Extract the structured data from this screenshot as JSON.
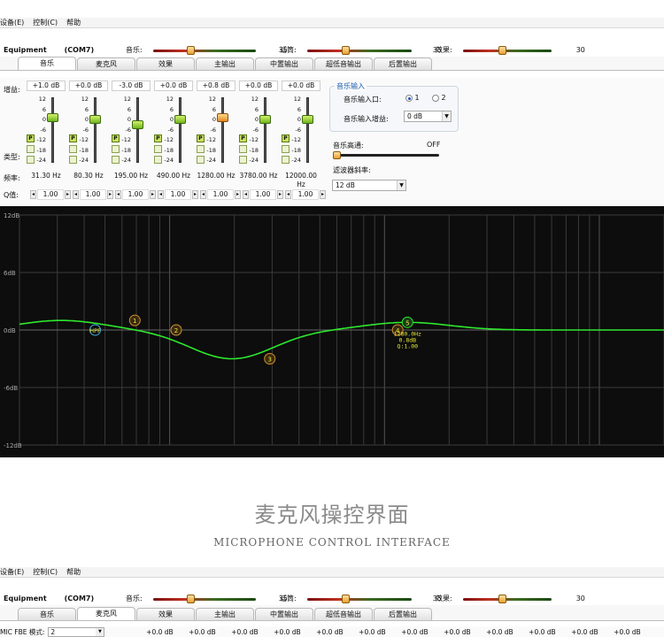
{
  "menu": [
    "设备(E)",
    "控制(C)",
    "帮助"
  ],
  "device": {
    "name": "Equipment",
    "port": "(COM7)"
  },
  "levels": [
    {
      "label": "音乐:",
      "value": "35",
      "position": 0.35
    },
    {
      "label": "话筒:",
      "value": "35",
      "position": 0.35
    },
    {
      "label": "效果:",
      "value": "30",
      "position": 0.3
    }
  ],
  "tabs": [
    "音乐",
    "麦克风",
    "效果",
    "主输出",
    "中置输出",
    "超低音输出",
    "后置输出"
  ],
  "active_tab_top": 0,
  "active_tab_bottom": 1,
  "eq": {
    "row_labels": {
      "gain": "增益:",
      "type": "类型:",
      "freq": "频率:",
      "q": "Q值:"
    },
    "scale": [
      "12",
      "6",
      "0",
      "-6",
      "-12",
      "-18",
      "-24"
    ],
    "type_badge": "P",
    "bands": [
      {
        "gain": "+1.0 dB",
        "freq": "31.30 Hz",
        "q": "1.00",
        "level": 1.0,
        "highlight": false
      },
      {
        "gain": "+0.0 dB",
        "freq": "80.30 Hz",
        "q": "1.00",
        "level": 0.0,
        "highlight": false
      },
      {
        "gain": "-3.0 dB",
        "freq": "195.00 Hz",
        "q": "1.00",
        "level": -3.0,
        "highlight": false
      },
      {
        "gain": "+0.0 dB",
        "freq": "490.00 Hz",
        "q": "1.00",
        "level": 0.0,
        "highlight": false
      },
      {
        "gain": "+0.8 dB",
        "freq": "1280.00 Hz",
        "q": "1.00",
        "level": 0.8,
        "highlight": true
      },
      {
        "gain": "+0.0 dB",
        "freq": "3780.00 Hz",
        "q": "1.00",
        "level": 0.0,
        "highlight": false
      },
      {
        "gain": "+0.0 dB",
        "freq": "12000.00 Hz",
        "q": "1.00",
        "level": 0.0,
        "highlight": false
      }
    ]
  },
  "music_input": {
    "title": "音乐输入",
    "port_label": "音乐输入口:",
    "options": [
      "1",
      "2"
    ],
    "selected": "1",
    "gain_label": "音乐输入增益:",
    "gain_value": "0 dB"
  },
  "highpass": {
    "label": "音乐高通:",
    "value": "OFF",
    "position": 0.0
  },
  "slope": {
    "label": "滤波器斜率:",
    "value": "12 dB"
  },
  "graph": {
    "y_ticks": [
      "12dB",
      "6dB",
      "0dB",
      "-6dB",
      "-12dB"
    ],
    "hpf_label": "HPF",
    "node_labels": [
      "1",
      "2",
      "3",
      "4",
      "5"
    ],
    "selected_info": [
      "1280.0Hz",
      "0.8dB",
      "Q:1.00"
    ],
    "colors": {
      "curve": "#2ee82e",
      "grid": "#3a3a3a",
      "info": "#e8e83a"
    }
  },
  "caption": {
    "cn": "麦克风操控界面",
    "en": "MICROPHONE CONTROL INTERFACE"
  },
  "bottom": {
    "mode_label": "MIC FBE 模式:",
    "mode_value": "2",
    "gains": [
      "+0.0 dB",
      "+0.0 dB",
      "+0.0 dB",
      "+0.0 dB",
      "+0.0 dB",
      "+0.0 dB",
      "+0.0 dB",
      "+0.0 dB",
      "+0.0 dB",
      "+0.0 dB",
      "+0.0 dB",
      "+0.0 dB"
    ]
  }
}
